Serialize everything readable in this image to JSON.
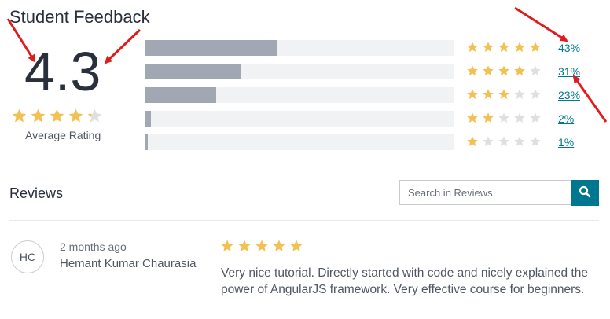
{
  "header": {
    "title": "Student Feedback"
  },
  "summary": {
    "rating": "4.3",
    "rating_value": 4.3,
    "label": "Average Rating"
  },
  "breakdown": [
    {
      "stars": 5,
      "percent_label": "43%",
      "percent": 43
    },
    {
      "stars": 4,
      "percent_label": "31%",
      "percent": 31
    },
    {
      "stars": 3,
      "percent_label": "23%",
      "percent": 23
    },
    {
      "stars": 2,
      "percent_label": "2%",
      "percent": 2
    },
    {
      "stars": 1,
      "percent_label": "1%",
      "percent": 1
    }
  ],
  "reviews": {
    "heading": "Reviews",
    "search_placeholder": "Search in Reviews",
    "search_icon": "search-icon",
    "items": [
      {
        "initials": "HC",
        "time": "2 months ago",
        "author": "Hemant Kumar Chaurasia",
        "rating": 5,
        "text": "Very nice tutorial. Directly started with code and nicely explained the power of AngularJS framework. Very effective course for beginners."
      }
    ]
  },
  "colors": {
    "star_filled": "#f4c150",
    "star_empty": "#dedfe0",
    "bar_fill": "#a1a7b3",
    "bar_track": "#f1f2f4",
    "link": "#007791",
    "annotation_arrow": "#e11b1b"
  }
}
